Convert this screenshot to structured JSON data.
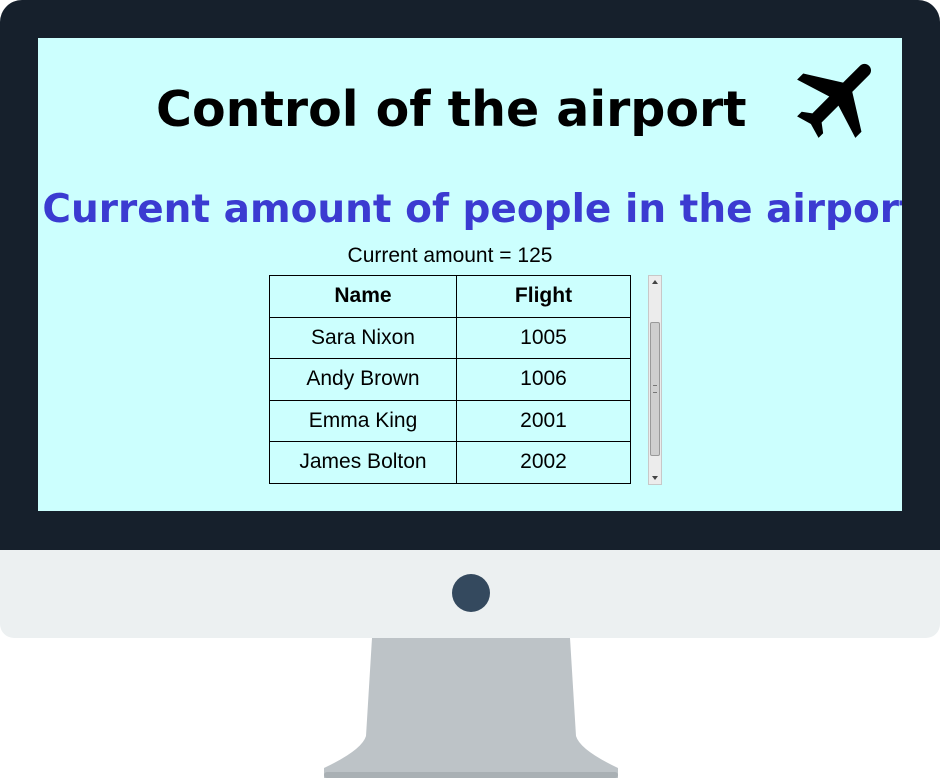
{
  "screen": {
    "title": "Control of the airport",
    "title_icon": "airplane-icon",
    "subtitle": "Current amount of people in the airport",
    "amount_label": "Current amount = ",
    "amount_value": "125"
  },
  "table": {
    "headers": [
      "Name",
      "Flight"
    ],
    "rows": [
      {
        "name": "Sara Nixon",
        "flight": "1005"
      },
      {
        "name": "Andy Brown",
        "flight": "1006"
      },
      {
        "name": "Emma King",
        "flight": "2001"
      },
      {
        "name": "James Bolton",
        "flight": "2002"
      }
    ]
  },
  "colors": {
    "screen_background": "#ccfffe",
    "subtitle": "#3b3bd1",
    "monitor_frame": "#16202c",
    "monitor_chin": "#ecf0f1",
    "power_button": "#34495e",
    "stand": "#bdc3c7"
  }
}
